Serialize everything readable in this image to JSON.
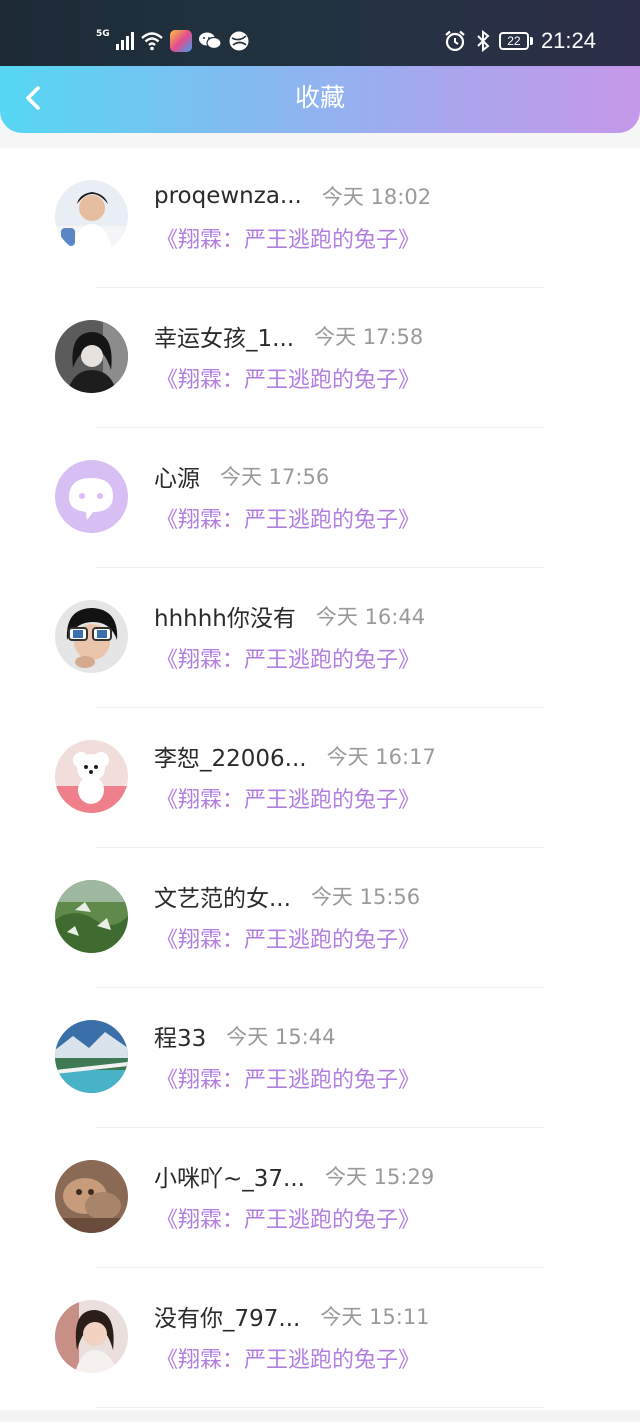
{
  "status": {
    "network": "5G",
    "battery": "22",
    "time": "21:24",
    "icons": [
      "signal-icon",
      "wifi-icon",
      "app-icon",
      "wechat-icon",
      "browser-icon",
      "alarm-icon",
      "bluetooth-icon",
      "battery-icon"
    ]
  },
  "header": {
    "title": "收藏",
    "back_icon": "chevron-left-icon",
    "gradient": [
      "#55d7f3",
      "#c598ea"
    ]
  },
  "colors": {
    "accent": "#b07fe0",
    "name": "#2b2b2b",
    "time": "#9a9a9a"
  },
  "items": [
    {
      "name": "proqewnza...",
      "time": "今天 18:02",
      "quote": "《翔霖：严王逃跑的兔子》",
      "avatar": "person-photo"
    },
    {
      "name": "幸运女孩_1...",
      "time": "今天 17:58",
      "quote": "《翔霖：严王逃跑的兔子》",
      "avatar": "dark-portrait-photo"
    },
    {
      "name": "心源",
      "time": "今天 17:56",
      "quote": "《翔霖：严王逃跑的兔子》",
      "avatar": "default-chat-icon"
    },
    {
      "name": "hhhhh你没有",
      "time": "今天 16:44",
      "quote": "《翔霖：严王逃跑的兔子》",
      "avatar": "sunglasses-photo"
    },
    {
      "name": "李恕_22006...",
      "time": "今天 16:17",
      "quote": "《翔霖：严王逃跑的兔子》",
      "avatar": "dog-photo"
    },
    {
      "name": "文艺范的女...",
      "time": "今天 15:56",
      "quote": "《翔霖：严王逃跑的兔子》",
      "avatar": "nature-photo"
    },
    {
      "name": "程33",
      "time": "今天 15:44",
      "quote": "《翔霖：严王逃跑的兔子》",
      "avatar": "landscape-photo"
    },
    {
      "name": "小咪吖~_37...",
      "time": "今天 15:29",
      "quote": "《翔霖：严王逃跑的兔子》",
      "avatar": "cat-photo"
    },
    {
      "name": "没有你_797...",
      "time": "今天 15:11",
      "quote": "《翔霖：严王逃跑的兔子》",
      "avatar": "girl-photo"
    }
  ]
}
